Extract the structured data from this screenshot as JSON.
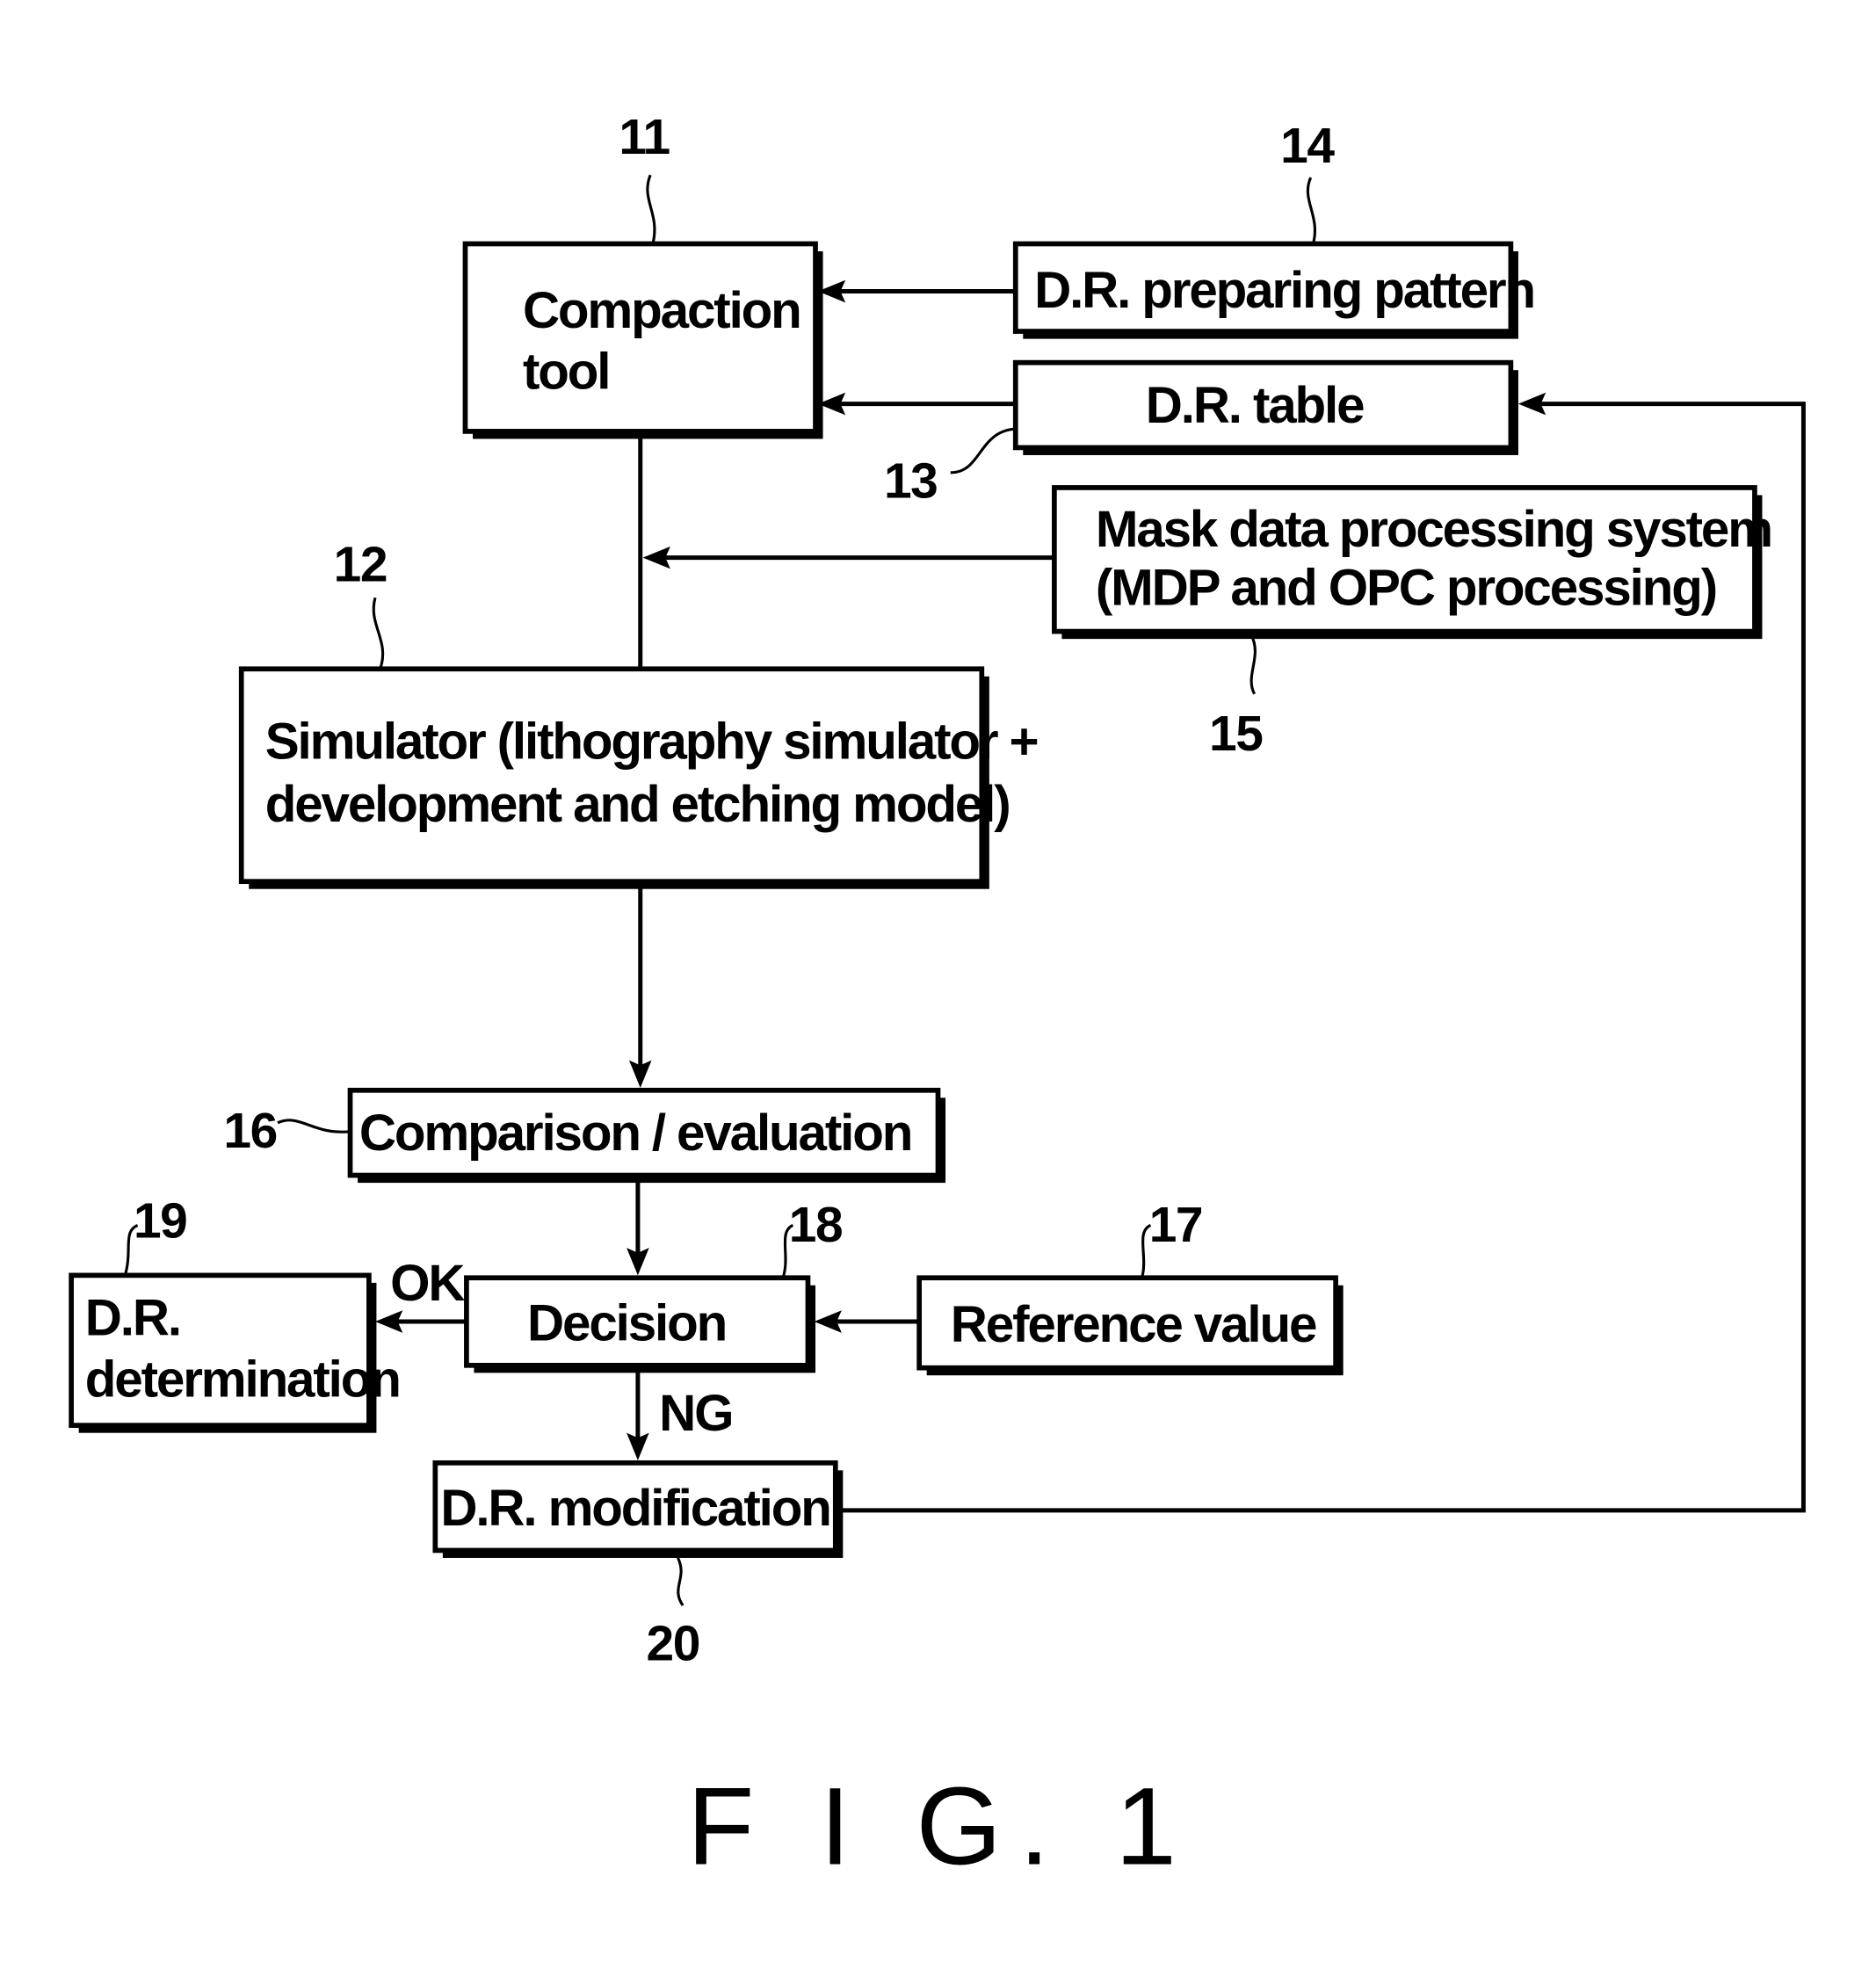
{
  "figure": {
    "caption": "F I G. 1",
    "blocks": [
      {
        "id": "11",
        "ref": "11",
        "lines": [
          "Compaction",
          "tool"
        ]
      },
      {
        "id": "12",
        "ref": "12",
        "lines": [
          "Simulator  (lithography  simulator +",
          "development  and  etching  model)"
        ]
      },
      {
        "id": "13",
        "ref": "13",
        "lines": [
          "D.R. table"
        ]
      },
      {
        "id": "14",
        "ref": "14",
        "lines": [
          "D.R. preparing  pattern"
        ]
      },
      {
        "id": "15",
        "ref": "15",
        "lines": [
          "Mask  data  processing  system",
          "(MDP  and  OPC  processing)"
        ]
      },
      {
        "id": "16",
        "ref": "16",
        "lines": [
          "Comparison / evaluation"
        ]
      },
      {
        "id": "17",
        "ref": "17",
        "lines": [
          "Reference  value"
        ]
      },
      {
        "id": "18",
        "ref": "18",
        "lines": [
          "Decision"
        ]
      },
      {
        "id": "19",
        "ref": "19",
        "lines": [
          "D.R.",
          "determination"
        ]
      },
      {
        "id": "20",
        "ref": "20",
        "lines": [
          "D.R. modification"
        ]
      }
    ],
    "edge_labels": {
      "ok": "OK",
      "ng": "NG"
    },
    "connections": [
      {
        "from": "14",
        "to": "11"
      },
      {
        "from": "13",
        "to": "11"
      },
      {
        "from": "11",
        "to": "12"
      },
      {
        "from": "15",
        "to": "11-12 line"
      },
      {
        "from": "12",
        "to": "16"
      },
      {
        "from": "16",
        "to": "18"
      },
      {
        "from": "17",
        "to": "18"
      },
      {
        "from": "18",
        "to": "19",
        "label": "OK"
      },
      {
        "from": "18",
        "to": "20",
        "label": "NG"
      },
      {
        "from": "20",
        "to": "13"
      }
    ]
  }
}
